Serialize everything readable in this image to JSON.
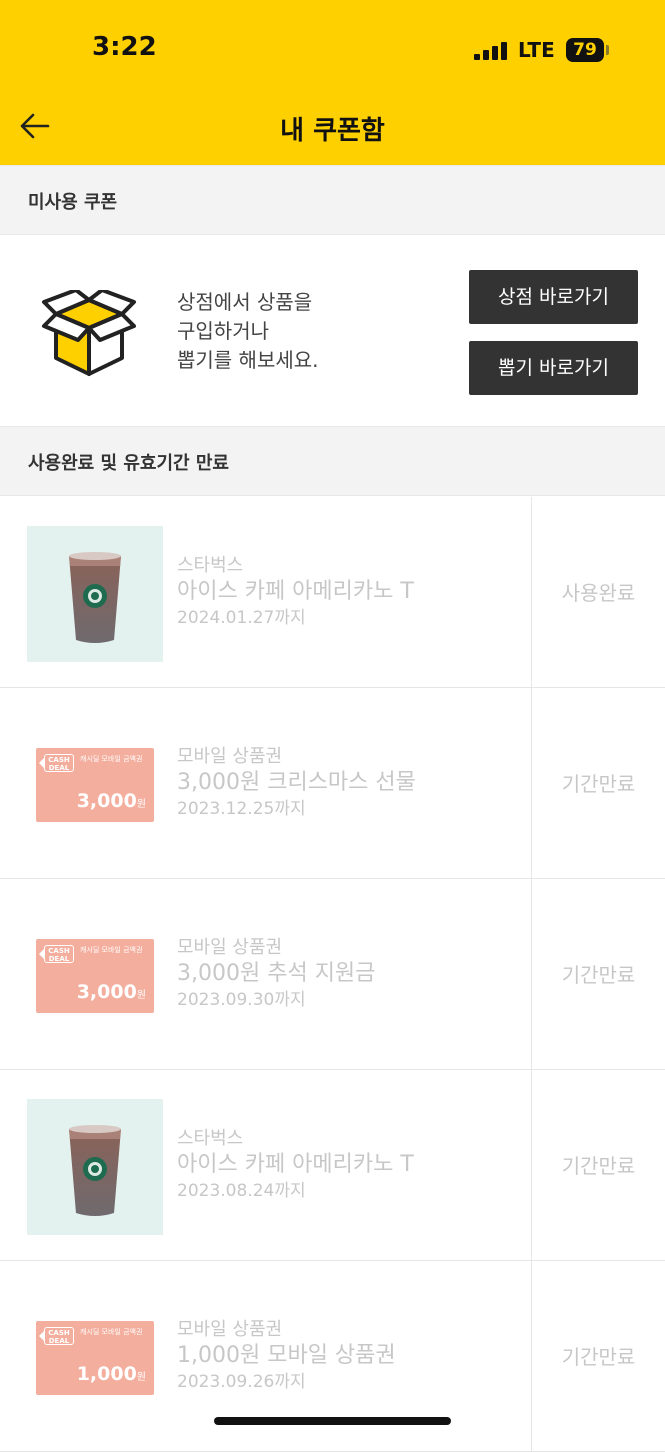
{
  "status_bar": {
    "time": "3:22",
    "network": "LTE",
    "battery": "79"
  },
  "header": {
    "title": "내 쿠폰함",
    "back_icon": "arrow-left-icon"
  },
  "unused_section": {
    "title": "미사용 쿠폰",
    "empty_icon": "open-box-icon",
    "empty_message": [
      "상점에서 상품을",
      "구입하거나",
      "뽑기를 해보세요."
    ],
    "store_button": "상점 바로가기",
    "draw_button": "뽑기 바로가기"
  },
  "used_section": {
    "title": "사용완료 및 유효기간 만료",
    "items": [
      {
        "thumb": "starbucks",
        "brand": "스타벅스",
        "name": "아이스 카페 아메리카노 T",
        "date": "2024.01.27까지",
        "status": "사용완료"
      },
      {
        "thumb": "cash",
        "badge": "CASH DEAL",
        "small_text": "캐시딜 모바일 금액권",
        "amount": "3,000",
        "unit": "원",
        "brand": "모바일 상품권",
        "name": "3,000원 크리스마스 선물",
        "date": "2023.12.25까지",
        "status": "기간만료"
      },
      {
        "thumb": "cash",
        "badge": "CASH DEAL",
        "small_text": "캐시딜 모바일 금액권",
        "amount": "3,000",
        "unit": "원",
        "brand": "모바일 상품권",
        "name": "3,000원 추석 지원금",
        "date": "2023.09.30까지",
        "status": "기간만료"
      },
      {
        "thumb": "starbucks",
        "brand": "스타벅스",
        "name": "아이스 카페 아메리카노 T",
        "date": "2023.08.24까지",
        "status": "기간만료"
      },
      {
        "thumb": "cash",
        "badge": "CASH DEAL",
        "small_text": "캐시딜 모바일 금액권",
        "amount": "1,000",
        "unit": "원",
        "brand": "모바일 상품권",
        "name": "1,000원 모바일 상품권",
        "date": "2023.09.26까지",
        "status": "기간만료"
      }
    ]
  },
  "colors": {
    "header": "#FFD000",
    "button": "#333333",
    "cash_card": "#F4AE9E",
    "faded_text": "#c7c7c7"
  }
}
